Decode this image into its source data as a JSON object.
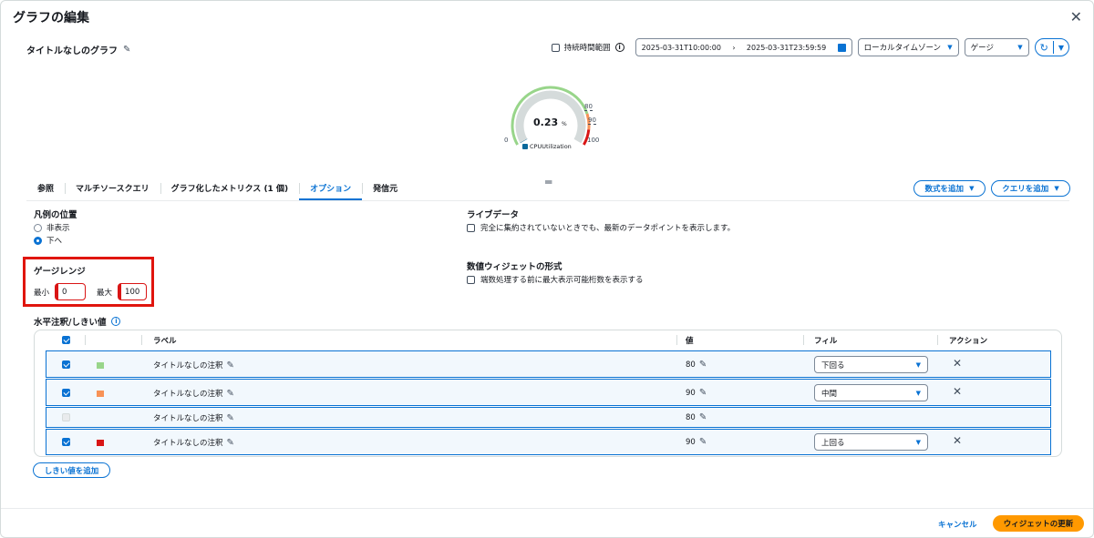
{
  "modal": {
    "title": "グラフの編集",
    "close": "✕"
  },
  "graph": {
    "title": "タイトルなしのグラフ"
  },
  "toolbar": {
    "persist_label": "持続時間範囲",
    "range_start": "2025-03-31T10:00:00",
    "range_end": "2025-03-31T23:59:59",
    "timezone": "ローカルタイムゾーン",
    "widget_type": "ゲージ"
  },
  "gauge": {
    "value": "0.23",
    "unit": "%",
    "min_label": "0",
    "max_label": "100",
    "th1_label": "80",
    "th2_label": "90",
    "metric": "CPUUtilization",
    "value_num": 0.23,
    "min_num": 0,
    "max_num": 100,
    "colors": {
      "track": "#d5dbdb",
      "green": "#98d58a",
      "orange": "#f89256",
      "red": "#d91515",
      "series": "#08689b"
    }
  },
  "tabs": [
    {
      "label": "参照"
    },
    {
      "label": "マルチソースクエリ"
    },
    {
      "label": "グラフ化したメトリクス (1 個)"
    },
    {
      "label": "オプション"
    },
    {
      "label": "発信元"
    }
  ],
  "buttons": {
    "add_formula": "数式を追加",
    "add_query": "クエリを追加",
    "add_threshold": "しきい値を追加",
    "cancel": "キャンセル",
    "update": "ウィジェットの更新"
  },
  "legend_position": {
    "title": "凡例の位置",
    "options": [
      "非表示",
      "下へ"
    ],
    "selected": "下へ"
  },
  "live_data": {
    "title": "ライブデータ",
    "checkbox": "完全に集約されていないときでも、最新のデータポイントを表示します。"
  },
  "gauge_range": {
    "title": "ゲージレンジ",
    "min_label": "最小",
    "min_value": "0",
    "max_label": "最大",
    "max_value": "100"
  },
  "number_format": {
    "title": "数値ウィジェットの形式",
    "checkbox": "端数処理する前に最大表示可能桁数を表示する"
  },
  "annotations": {
    "title": "水平注釈/しきい値",
    "headers": {
      "label": "ラベル",
      "value": "値",
      "fill": "フィル",
      "action": "アクション"
    },
    "rows": [
      {
        "label": "タイトルなしの注釈",
        "value": "80",
        "fill": "下回る",
        "color": "#98d58a",
        "checked": true
      },
      {
        "label": "タイトルなしの注釈",
        "value": "90",
        "fill": "中間",
        "color": "#f89256",
        "checked": true
      },
      {
        "label": "タイトルなしの注釈",
        "value": "80",
        "fill": "",
        "color": "",
        "checked": false
      },
      {
        "label": "タイトルなしの注釈",
        "value": "90",
        "fill": "上回る",
        "color": "#d91515",
        "checked": true
      }
    ]
  },
  "colors": {
    "accent": "#0972d3",
    "highlight": "#e0150e",
    "primary_button": "#ff9900"
  }
}
